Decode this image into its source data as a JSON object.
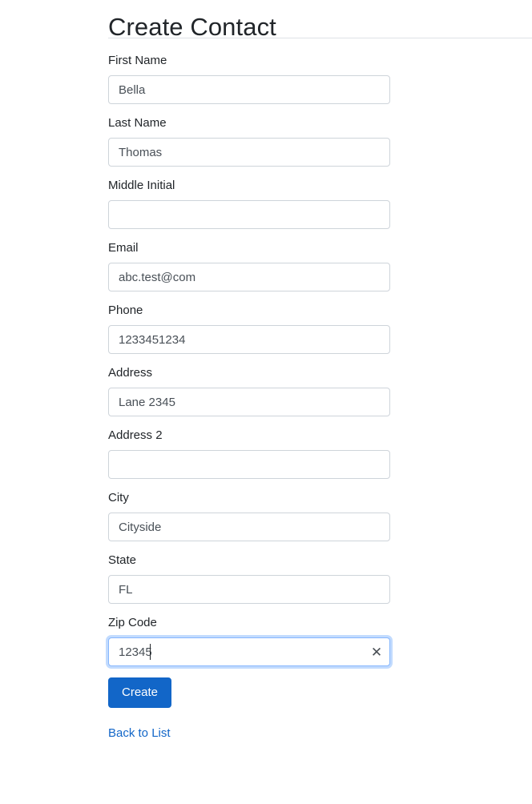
{
  "page": {
    "title": "Create Contact"
  },
  "form": {
    "fields": [
      {
        "label": "First Name",
        "value": "Bella",
        "placeholder": "",
        "focused": false
      },
      {
        "label": "Last Name",
        "value": "Thomas",
        "placeholder": "",
        "focused": false
      },
      {
        "label": "Middle Initial",
        "value": "",
        "placeholder": "",
        "focused": false
      },
      {
        "label": "Email",
        "value": "abc.test@com",
        "placeholder": "",
        "focused": false
      },
      {
        "label": "Phone",
        "value": "1233451234",
        "placeholder": "",
        "focused": false
      },
      {
        "label": "Address",
        "value": "Lane 2345",
        "placeholder": "",
        "focused": false
      },
      {
        "label": "Address 2",
        "value": "",
        "placeholder": "",
        "focused": false
      },
      {
        "label": "City",
        "value": "Cityside",
        "placeholder": "",
        "focused": false
      },
      {
        "label": "State",
        "value": "FL",
        "placeholder": "",
        "focused": false
      },
      {
        "label": "Zip Code",
        "value": "12345",
        "placeholder": "",
        "focused": true
      }
    ],
    "clear_icon": "✕",
    "clear_icon_name": "clear-input-icon"
  },
  "actions": {
    "submit_label": "Create",
    "back_link_label": "Back to List"
  },
  "colors": {
    "primary": "#1266c8",
    "link": "#1266c8",
    "input_border": "#ced4da",
    "focus_border": "#86b7fe",
    "rule": "#dee2e6",
    "text": "#212529",
    "input_text": "#495057"
  }
}
